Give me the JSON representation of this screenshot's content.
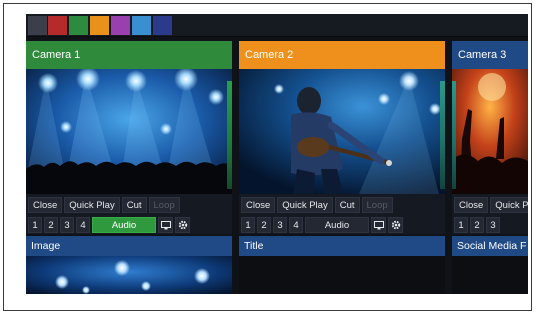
{
  "swatches": [
    {
      "color": "#3a3f4a"
    },
    {
      "color": "#b52a2a"
    },
    {
      "color": "#2e8b3e"
    },
    {
      "color": "#e8921c"
    },
    {
      "color": "#9a3fae"
    },
    {
      "color": "#3a8fd0"
    },
    {
      "color": "#2c3a8c"
    }
  ],
  "cameras": [
    {
      "title": "Camera 1",
      "header_color": "#2f8a3c",
      "buttons": {
        "close": "Close",
        "quick_play": "Quick Play",
        "cut": "Cut",
        "loop": "Loop"
      },
      "numbers": [
        "1",
        "2",
        "3",
        "4"
      ],
      "audio": "Audio",
      "audio_active": true
    },
    {
      "title": "Camera 2",
      "header_color": "#f0901c",
      "buttons": {
        "close": "Close",
        "quick_play": "Quick Play",
        "cut": "Cut",
        "loop": "Loop"
      },
      "numbers": [
        "1",
        "2",
        "3",
        "4"
      ],
      "audio": "Audio",
      "audio_active": false
    },
    {
      "title": "Camera 3",
      "header_color": "#1f4a86",
      "buttons": {
        "close": "Close",
        "quick_play": "Quick Play"
      },
      "numbers": [
        "1",
        "2",
        "3"
      ]
    }
  ],
  "bottom_panels": [
    {
      "title": "Image"
    },
    {
      "title": "Title"
    },
    {
      "title": "Social Media F"
    }
  ],
  "icons": {
    "monitor": "monitor-icon",
    "settings": "gear-icon"
  }
}
